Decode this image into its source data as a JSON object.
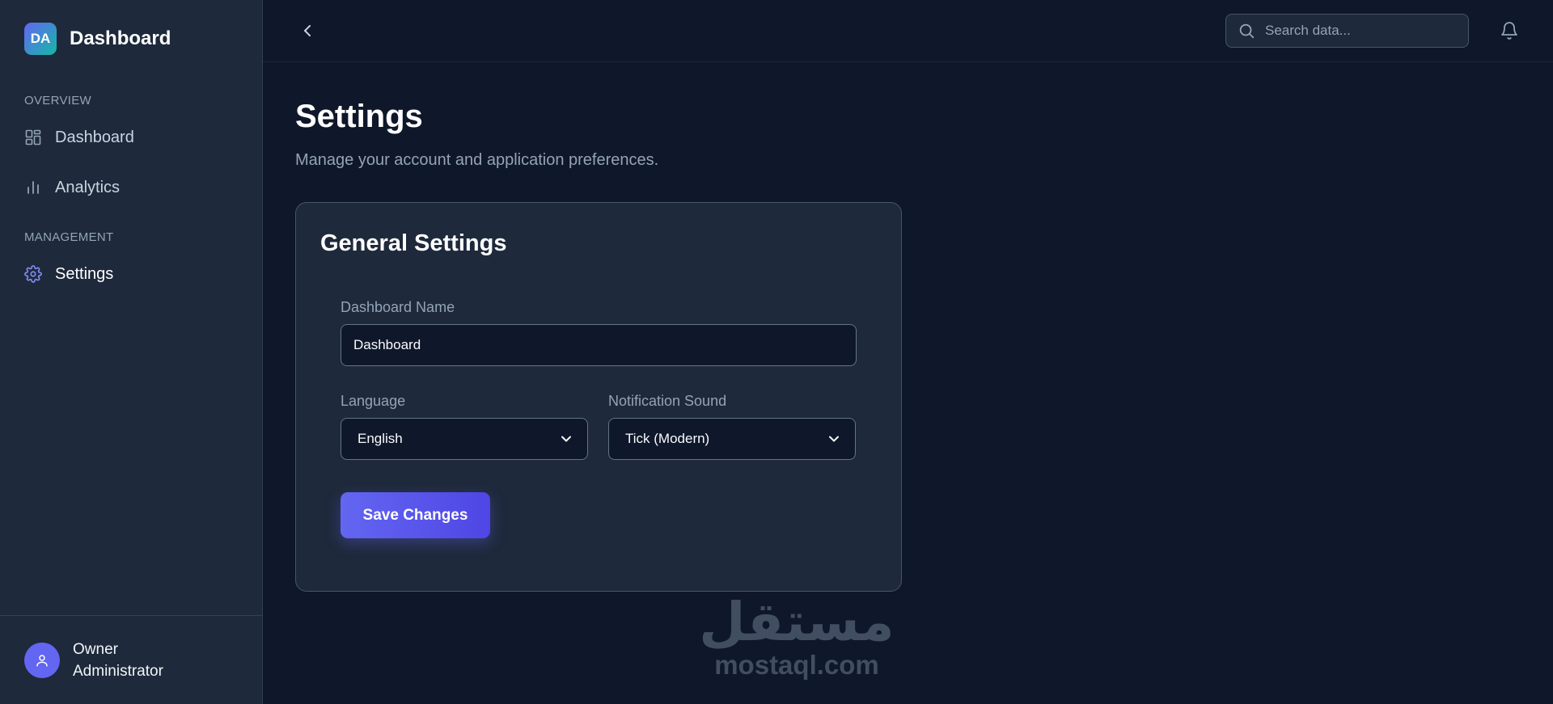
{
  "brand": {
    "logo_text": "DA",
    "name": "Dashboard"
  },
  "sidebar": {
    "sections": [
      {
        "label": "OVERVIEW",
        "items": [
          {
            "label": "Dashboard",
            "icon": "grid-icon",
            "active": false
          },
          {
            "label": "Analytics",
            "icon": "bar-chart-icon",
            "active": false
          }
        ]
      },
      {
        "label": "MANAGEMENT",
        "items": [
          {
            "label": "Settings",
            "icon": "gear-icon",
            "active": true
          }
        ]
      }
    ],
    "user": {
      "role": "Owner",
      "title": "Administrator"
    }
  },
  "topbar": {
    "search_placeholder": "Search data..."
  },
  "page": {
    "title": "Settings",
    "subtitle": "Manage your account and application preferences."
  },
  "card": {
    "title": "General Settings",
    "dashboard_name_label": "Dashboard Name",
    "dashboard_name_value": "Dashboard",
    "language_label": "Language",
    "language_value": "English",
    "sound_label": "Notification Sound",
    "sound_value": "Tick (Modern)",
    "save_label": "Save Changes"
  },
  "watermark": {
    "arabic": "مستقل",
    "latin": "mostaql.com"
  },
  "colors": {
    "accent": "#6366f1",
    "background": "#0f172a",
    "panel": "#1e293b"
  }
}
